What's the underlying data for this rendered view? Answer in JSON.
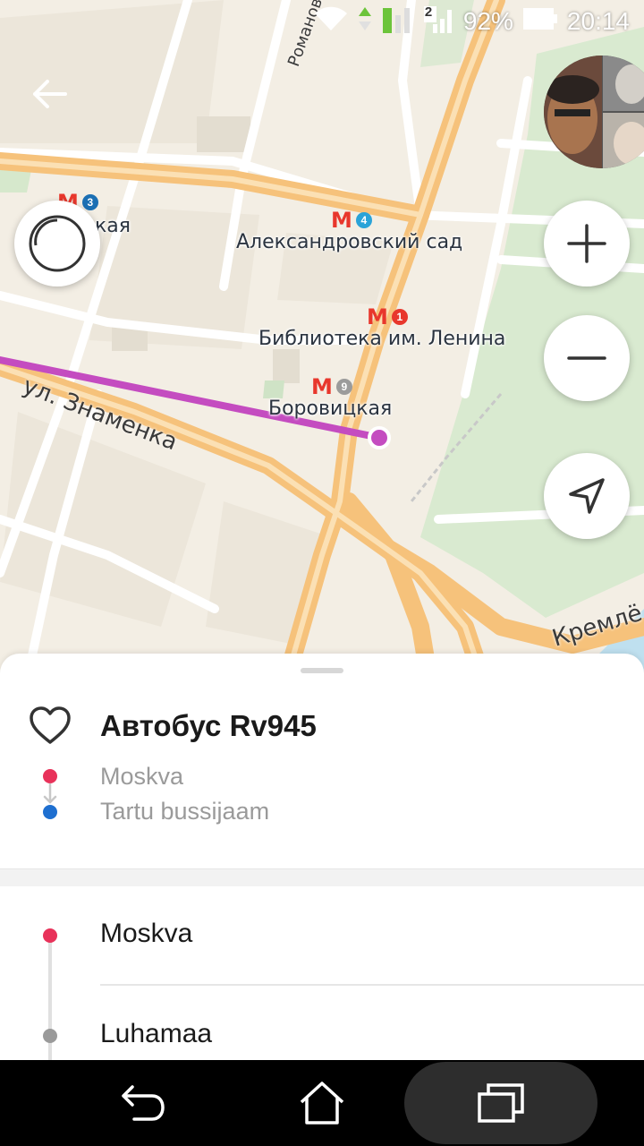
{
  "status_bar": {
    "battery_percent": "92%",
    "time": "20:14",
    "sim_label": "2",
    "icons": [
      "wifi-icon",
      "data-arrows-icon",
      "signal-icon",
      "signal-icon",
      "battery-icon"
    ]
  },
  "map": {
    "stations": [
      {
        "name": "Александровский сад",
        "line": "4",
        "line_color": "#2aa3d8"
      },
      {
        "name": "Библиотека им. Ленина",
        "line": "1",
        "line_color": "#e8372c"
      },
      {
        "name": "Боровицкая",
        "line": "9",
        "line_color": "#9b9b9b"
      },
      {
        "name": "Арбатская",
        "visible_fragment": "кая",
        "line": "3",
        "line_color": "#1b6fb3"
      }
    ],
    "streets": [
      "ул. Знаменка",
      "Романов",
      "Кремлё"
    ],
    "route_color": "#c44cc0",
    "metro_symbol": "М",
    "controls": {
      "zoom_in_icon": "plus-icon",
      "zoom_out_icon": "minus-icon",
      "locate_icon": "navigation-arrow-icon",
      "compass_icon": "compass-icon",
      "back_icon": "back-arrow-icon"
    }
  },
  "route": {
    "title": "Автобус Rv945",
    "from": "Moskva",
    "to": "Tartu bussijaam",
    "from_color": "#e8325a",
    "to_color": "#1e6fd0",
    "stops": [
      {
        "name": "Moskva",
        "color": "#e8325a"
      },
      {
        "name": "Luhamaa",
        "color": "#9a9a9a"
      }
    ]
  },
  "navbar": {
    "icons": [
      "back-icon",
      "home-icon",
      "recent-apps-icon"
    ]
  }
}
